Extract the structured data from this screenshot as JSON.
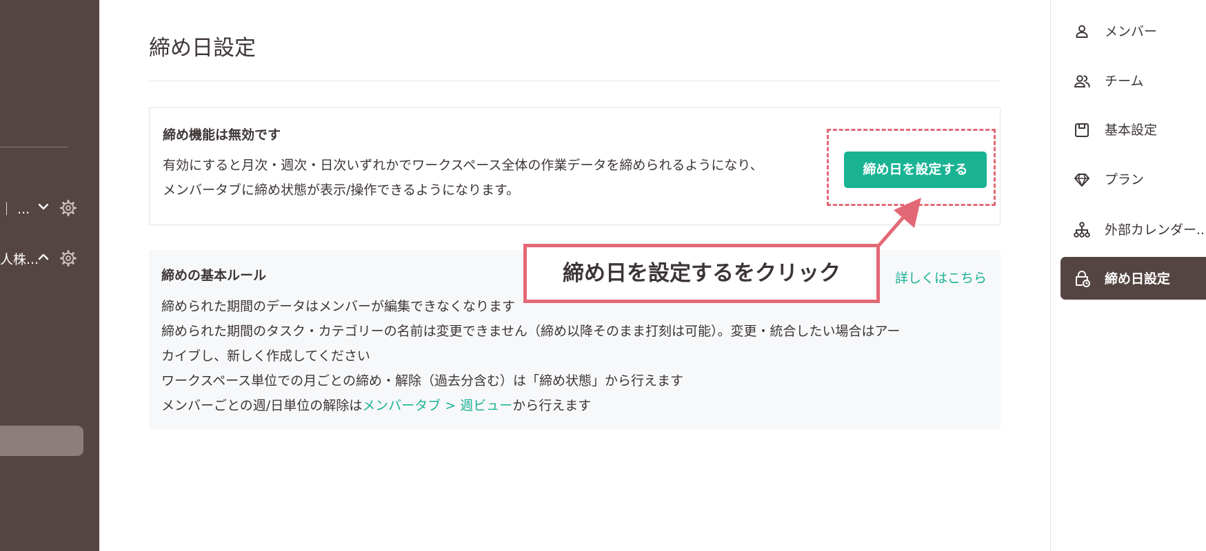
{
  "left_sidebar": {
    "items": [
      {
        "label": "｜ ...",
        "chevron": "chevron-down-icon",
        "icon": "gear-icon"
      },
      {
        "label": "人株...",
        "chevron": "chevron-up-icon",
        "icon": "gear-icon"
      }
    ]
  },
  "main": {
    "title": "締め日設定",
    "card": {
      "heading": "締め機能は無効です",
      "desc_line1": "有効にすると月次・週次・日次いずれかでワークスペース全体の作業データを締められるようになり、",
      "desc_line2": "メンバータブに締め状態が表示/操作できるようになります。",
      "button_label": "締め日を設定する"
    },
    "rules": {
      "heading": "締めの基本ルール",
      "detail_link": "詳しくはこちら",
      "line1": "締められた期間のデータはメンバーが編集できなくなります",
      "line2a": "締められた期間のタスク・カテゴリーの名前は変更できません（締め以降そのまま打刻は可能）。変更・統合したい場合はアー",
      "line2b": "カイブし、新しく作成してください",
      "line3": "ワークスペース単位での月ごとの締め・解除（過去分含む）は「締め状態」から行えます",
      "line4_prefix": "メンバーごとの週/日単位の解除は",
      "line4_link": "メンバータブ > 週ビュー",
      "line4_suffix": "から行えます"
    }
  },
  "annotation": {
    "text": "締め日を設定するをクリック",
    "color": "#e36876"
  },
  "right_nav": {
    "items": [
      {
        "label": "メンバー",
        "icon": "person-icon"
      },
      {
        "label": "チーム",
        "icon": "people-icon"
      },
      {
        "label": "基本設定",
        "icon": "box-icon"
      },
      {
        "label": "プラン",
        "icon": "diamond-icon"
      },
      {
        "label": "外部カレンダー...",
        "icon": "hierarchy-icon"
      },
      {
        "label": "締め日設定",
        "icon": "lock-clock-icon",
        "active": true
      }
    ]
  },
  "colors": {
    "sidebar": "#554542",
    "accent": "#19b394",
    "annotation": "#e36876"
  }
}
